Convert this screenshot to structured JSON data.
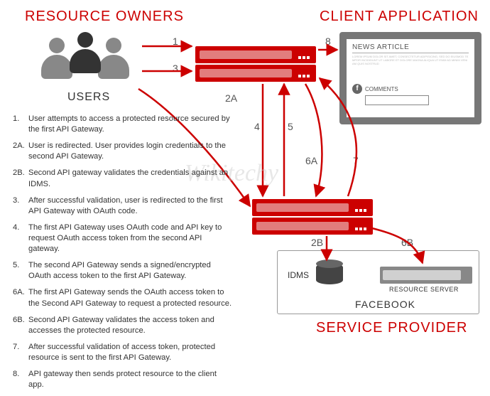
{
  "titles": {
    "resource_owners": "RESOURCE OWNERS",
    "client_application": "CLIENT APPLICATION",
    "service_provider": "SERVICE PROVIDER"
  },
  "labels": {
    "users": "USERS",
    "idms": "IDMS",
    "resource_server": "RESOURCE SERVER",
    "facebook": "FACEBOOK"
  },
  "client_window": {
    "header": "NEWS ARTICLE",
    "body": "LOREM IPSUM DOLOR SIT AMET, CONSECTETUR ADIPISICING, SED DO EIUSMOD TEMPOR INCIDIDUNT UT LABORE ET DOLORE MAGNA ALIQUA UT ENIM AD MINIM VENIAM QUIS NOSTRUD",
    "comments": "COMMENTS",
    "fb_glyph": "f"
  },
  "flow_labels": {
    "n1": "1",
    "n2a": "2A",
    "n2b": "2B",
    "n3": "3",
    "n4": "4",
    "n5": "5",
    "n6a": "6A",
    "n6b": "6B",
    "n7": "7",
    "n8": "8"
  },
  "steps": [
    {
      "n": "1.",
      "t": "User attempts to access a protected resource secured by the first API Gateway."
    },
    {
      "n": "2A.",
      "t": "User is redirected. User provides login credentials to the second API Gateway."
    },
    {
      "n": "2B.",
      "t": "Second API gateway validates the credentials against an IDMS."
    },
    {
      "n": "3.",
      "t": "After successful validation, user is redirected to the first API Gateway with OAuth code."
    },
    {
      "n": "4.",
      "t": "The first API Gateway uses OAuth code and API key to request OAuth access token from the second API gateway."
    },
    {
      "n": "5.",
      "t": "The second API Gateway sends a signed/encrypted OAuth access token to the first API Gateway."
    },
    {
      "n": "6A.",
      "t": "The first API Gateway sends the OAuth access token to the Second API Gateway to request a protected resource."
    },
    {
      "n": "6B.",
      "t": "Second API Gateway validates the access token and accesses the protected resource."
    },
    {
      "n": "7.",
      "t": "After successful validation of access token, protected resource is sent to the first API Gateway."
    },
    {
      "n": "8.",
      "t": "API gateway then sends protect resource to the client app."
    }
  ],
  "watermark": "Wikitechy"
}
